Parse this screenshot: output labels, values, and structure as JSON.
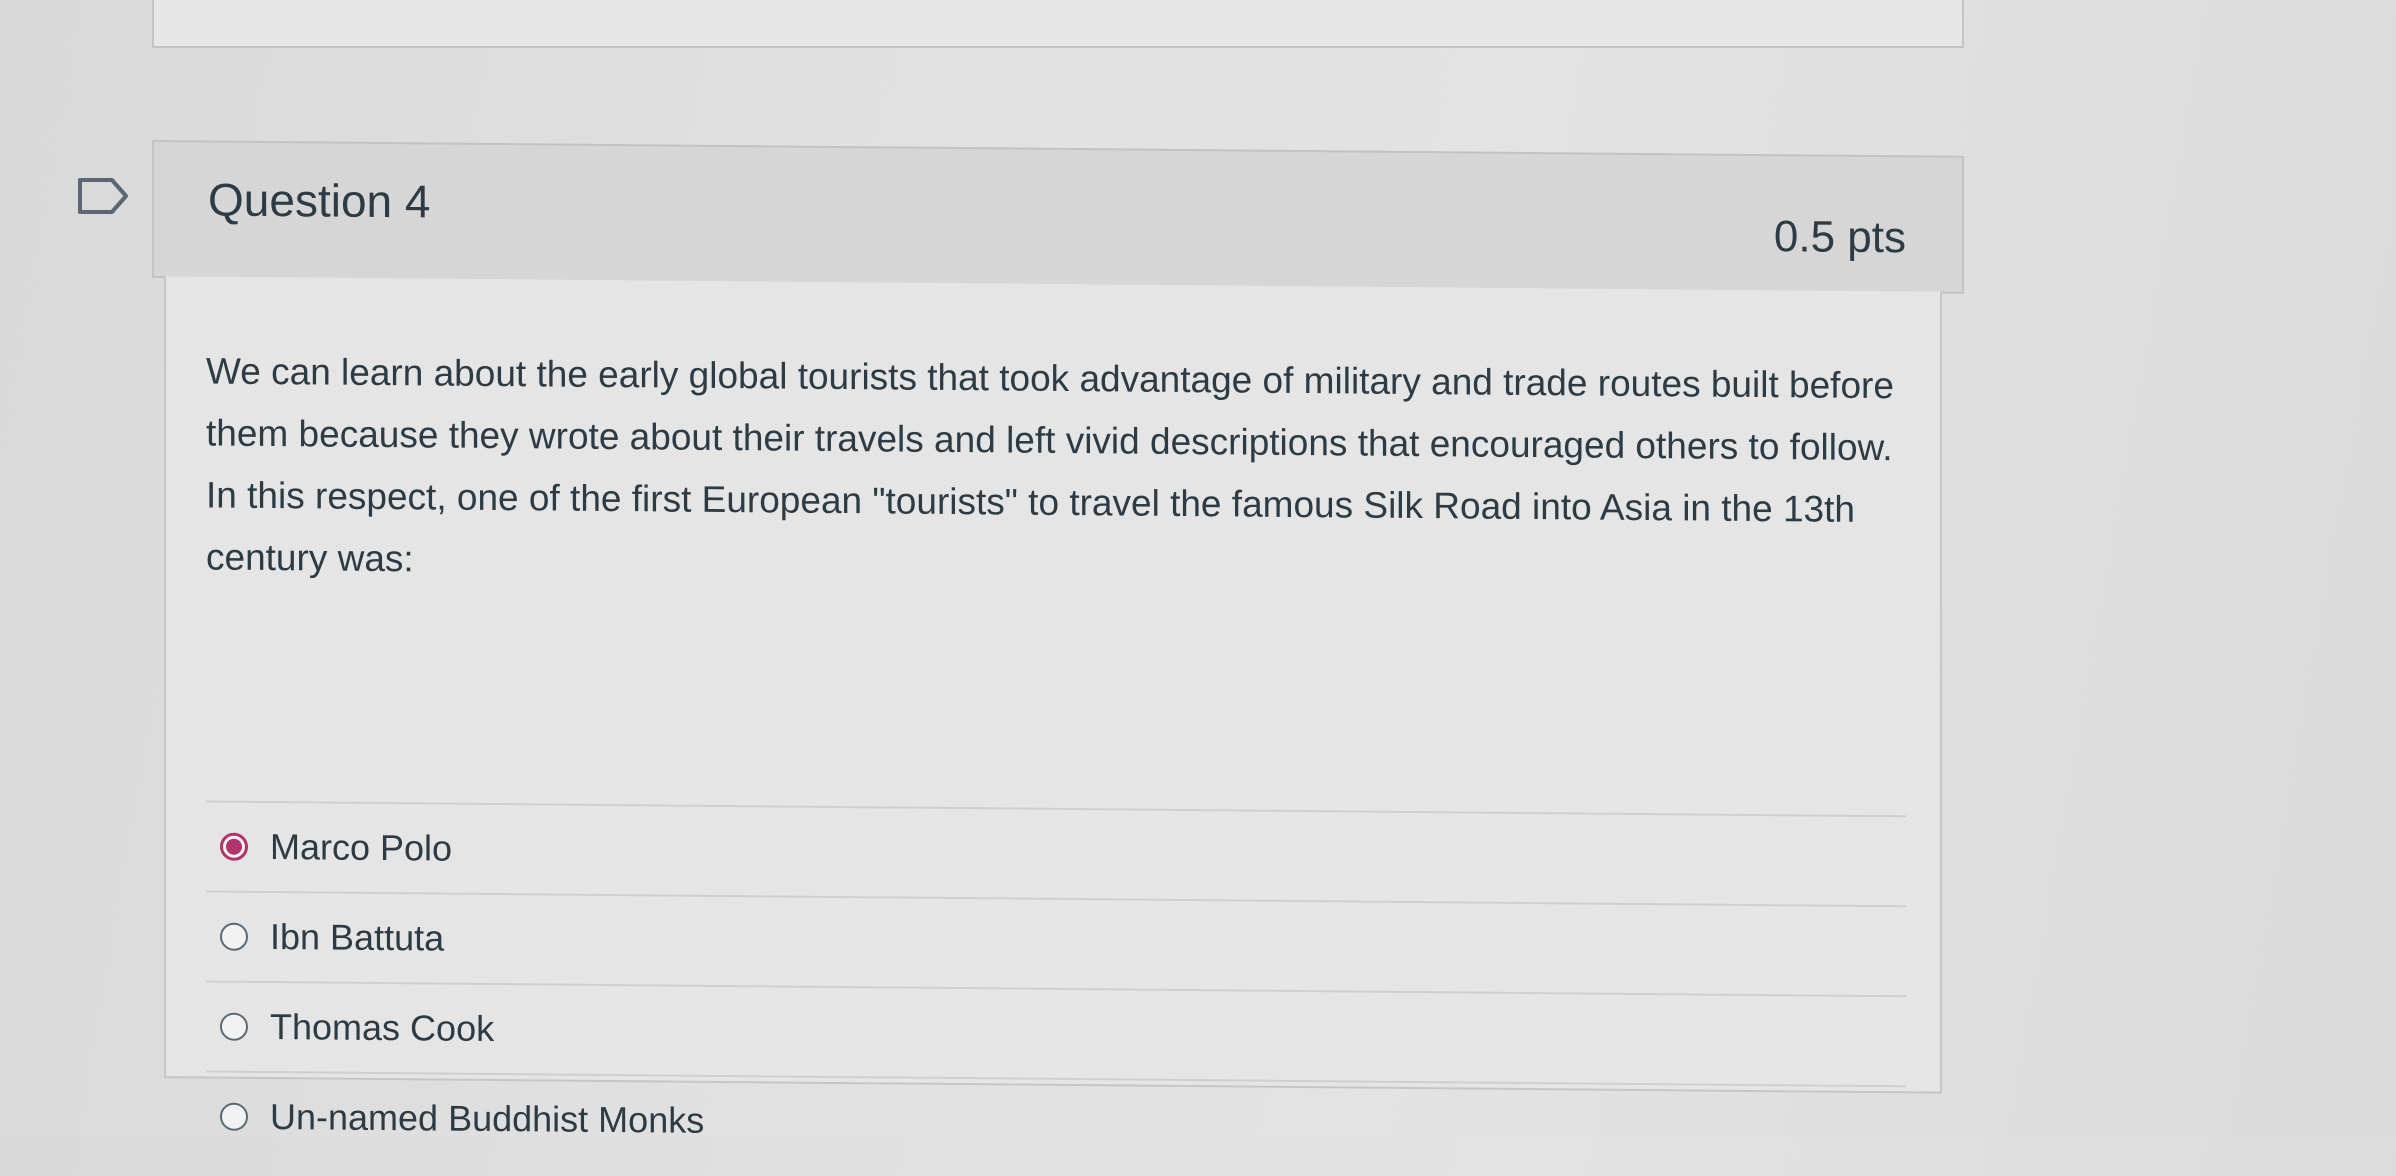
{
  "question": {
    "title": "Question 4",
    "points": "0.5 pts",
    "text": "We can learn about the early global tourists that took advantage of military and trade routes built before them because they wrote about their travels and left vivid descriptions that encouraged others to follow. In this respect, one of the first European \"tourists\" to travel the famous Silk Road into Asia in the 13th century was:",
    "answers": [
      {
        "label": "Marco Polo",
        "selected": true
      },
      {
        "label": "Ibn Battuta",
        "selected": false
      },
      {
        "label": "Thomas Cook",
        "selected": false
      },
      {
        "label": "Un-named Buddhist Monks",
        "selected": false
      }
    ]
  },
  "colors": {
    "accent": "#b1346d",
    "text": "#2d3b45",
    "header_bg": "#d6d6d6"
  },
  "icons": {
    "flag": "flag-icon"
  }
}
